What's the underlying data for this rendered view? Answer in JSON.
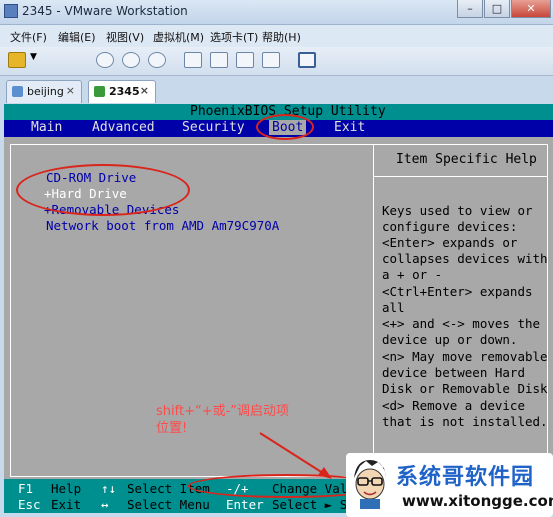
{
  "window": {
    "title": "2345 - VMware Workstation",
    "minimize": "–",
    "maximize": "□",
    "close": "✕"
  },
  "menu": [
    "文件(F)",
    "编辑(E)",
    "视图(V)",
    "虚拟机(M)",
    "选项卡(T)",
    "帮助(H)"
  ],
  "toolbar_icons": [
    "pause-icon",
    "dropdown-icon",
    "snapshot-icon",
    "revert-icon",
    "manage-snapshots-icon",
    "fullscreen-icon",
    "unity-icon",
    "console-view-icon",
    "thumbnail-icon",
    "quick-switch-icon"
  ],
  "tabs": [
    {
      "label": "beijing",
      "close": "×"
    },
    {
      "label": "2345",
      "close": "×"
    }
  ],
  "bios": {
    "title": "PhoenixBIOS Setup Utility",
    "menu": [
      "Main",
      "Advanced",
      "Security",
      "Boot",
      "Exit"
    ],
    "selected_menu": "Boot",
    "boot_devices": [
      "CD-ROM Drive",
      "+Hard Drive",
      "+Removable Devices",
      "Network boot from AMD Am79C970A"
    ],
    "help_title": "Item Specific Help",
    "help_lines": [
      "Keys used to view or",
      "configure devices:",
      "<Enter> expands or",
      "collapses devices with",
      "a + or -",
      "<Ctrl+Enter> expands",
      "all",
      "<+> and <-> moves the",
      "device up or down.",
      "<n> May move removable",
      "device between Hard",
      "Disk or Removable Disk",
      "<d> Remove a device",
      "that is not installed."
    ],
    "bottom_row1": {
      "k1": "F1",
      "t1": "Help",
      "k2": "↑↓",
      "t2": "Select Item",
      "k3": "-/+",
      "t3": "Change Values"
    },
    "bottom_row2": {
      "k1": "Esc",
      "t1": "Exit",
      "k2": "↔",
      "t2": "Select Menu",
      "k3": "Enter",
      "t3": "Select ► Sub-Menu"
    }
  },
  "annotation": {
    "line1": "shift+“+或-”调启动项",
    "line2": "位置!"
  },
  "watermark": {
    "name": "系统哥软件园",
    "url": "www.xitongge.com"
  },
  "colors": {
    "bios_blue": "#0000a8",
    "bios_cyan": "#008f8f",
    "bios_gray": "#a8a8a8",
    "annotation_red": "#d9251c"
  }
}
